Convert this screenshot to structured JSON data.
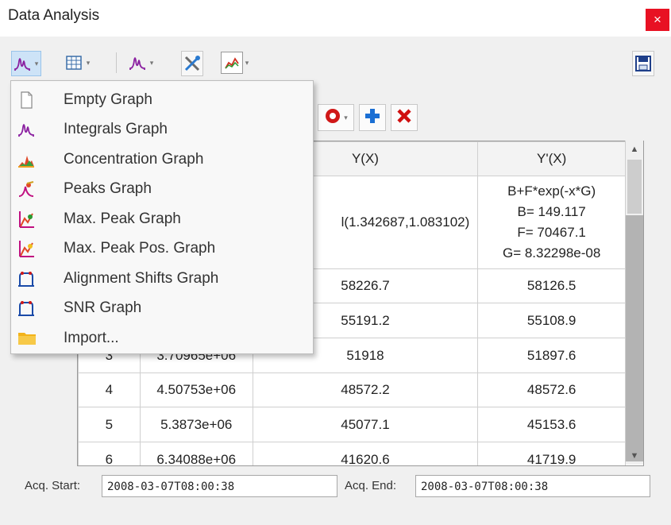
{
  "window": {
    "title": "Data Analysis",
    "close_glyph": "×"
  },
  "toolbar": {
    "buttons": [
      {
        "icon": "graph-icon",
        "has_dropdown": true
      },
      {
        "icon": "table-icon",
        "has_dropdown": true
      },
      {
        "icon": "graph-icon",
        "has_dropdown": true
      },
      {
        "icon": "tools-icon",
        "has_dropdown": false
      },
      {
        "icon": "chart-icon",
        "has_dropdown": true
      }
    ],
    "save_icon": "save-icon"
  },
  "action_bar": {
    "icons": [
      "settings-icon",
      "add-icon",
      "delete-icon"
    ]
  },
  "menu": {
    "items": [
      {
        "label": "Empty Graph",
        "icon": "empty-page-icon"
      },
      {
        "label": "Integrals Graph",
        "icon": "integrals-icon"
      },
      {
        "label": "Concentration Graph",
        "icon": "concentration-icon"
      },
      {
        "label": "Peaks Graph",
        "icon": "peaks-icon"
      },
      {
        "label": "Max. Peak Graph",
        "icon": "max-peak-icon"
      },
      {
        "label": "Max. Peak Pos. Graph",
        "icon": "max-peak-pos-icon"
      },
      {
        "label": "Alignment Shifts Graph",
        "icon": "alignment-icon"
      },
      {
        "label": "SNR Graph",
        "icon": "snr-icon"
      },
      {
        "label": "Import...",
        "icon": "folder-icon"
      }
    ]
  },
  "table": {
    "headers": [
      "",
      "",
      "Y(X)",
      "Y'(X)"
    ],
    "fit_row": {
      "yx": "l(1.342687,1.083102)",
      "ypx": [
        "B+F*exp(-x*G)",
        "B= 149.117",
        "F= 70467.1",
        "G= 8.32298e-08"
      ]
    },
    "rows": [
      {
        "idx": "",
        "x": "",
        "yx": "58226.7",
        "ypx": "58126.5"
      },
      {
        "idx": "",
        "x": "",
        "yx": "55191.2",
        "ypx": "55108.9"
      },
      {
        "idx": "3",
        "x": "3.70965e+06",
        "yx": "51918",
        "ypx": "51897.6"
      },
      {
        "idx": "4",
        "x": "4.50753e+06",
        "yx": "48572.2",
        "ypx": "48572.6"
      },
      {
        "idx": "5",
        "x": "5.3873e+06",
        "yx": "45077.1",
        "ypx": "45153.6"
      },
      {
        "idx": "6",
        "x": "6.34088e+06",
        "yx": "41620.6",
        "ypx": "41719.9"
      }
    ]
  },
  "footer": {
    "acq_start_label": "Acq. Start:",
    "acq_start_value": "2008-03-07T08:00:38",
    "acq_end_label": "Acq. End:",
    "acq_end_value": "2008-03-07T08:00:38"
  },
  "colors": {
    "close": "#e81123",
    "graph_icon": "#8a1fa0",
    "add": "#1a6fd4",
    "delete": "#d01010"
  }
}
